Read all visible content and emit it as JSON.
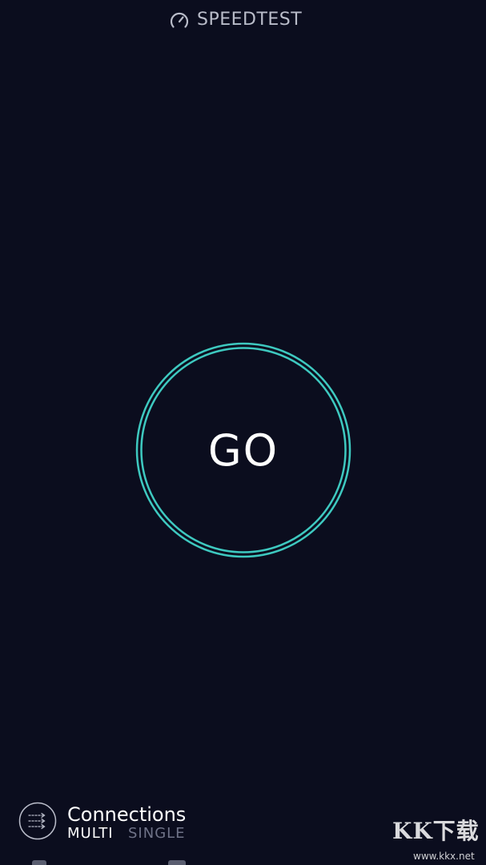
{
  "header": {
    "title": "SPEEDTEST",
    "icon": "speedometer-icon"
  },
  "go_button": {
    "label": "GO",
    "ring_color": "#3ec9c0"
  },
  "connections": {
    "icon": "connections-arrows-icon",
    "title": "Connections",
    "options": [
      "MULTI",
      "SINGLE"
    ],
    "selected": "MULTI"
  },
  "watermark": {
    "logo": "KK下载",
    "url": "www.kkx.net"
  },
  "colors": {
    "background": "#0b0d1e",
    "accent": "#3ec9c0",
    "muted_text": "#6f7388"
  }
}
